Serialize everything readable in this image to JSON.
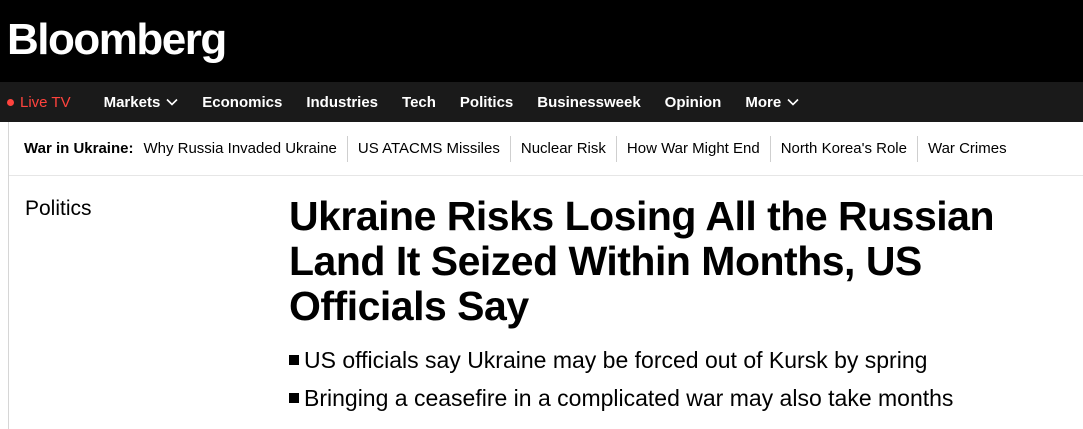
{
  "header": {
    "logo": "Bloomberg"
  },
  "nav": {
    "live_label": "Live TV",
    "items": [
      {
        "label": "Markets",
        "dropdown": true
      },
      {
        "label": "Economics",
        "dropdown": false
      },
      {
        "label": "Industries",
        "dropdown": false
      },
      {
        "label": "Tech",
        "dropdown": false
      },
      {
        "label": "Politics",
        "dropdown": false
      },
      {
        "label": "Businessweek",
        "dropdown": false
      },
      {
        "label": "Opinion",
        "dropdown": false
      },
      {
        "label": "More",
        "dropdown": true
      }
    ]
  },
  "topic_bar": {
    "title": "War in Ukraine:",
    "links": [
      "Why Russia Invaded Ukraine",
      "US ATACMS Missiles",
      "Nuclear Risk",
      "How War Might End",
      "North Korea's Role",
      "War Crimes"
    ]
  },
  "article": {
    "section": "Politics",
    "headline": "Ukraine Risks Losing All the Russian Land It Seized Within Months, US Officials Say",
    "bullets": [
      "US officials say Ukraine may be forced out of Kursk by spring",
      "Bringing a ceasefire in a complicated war may also take months"
    ]
  },
  "colors": {
    "masthead_bg": "#000000",
    "nav_bg": "#1a1a1a",
    "live_accent": "#ff433d"
  }
}
